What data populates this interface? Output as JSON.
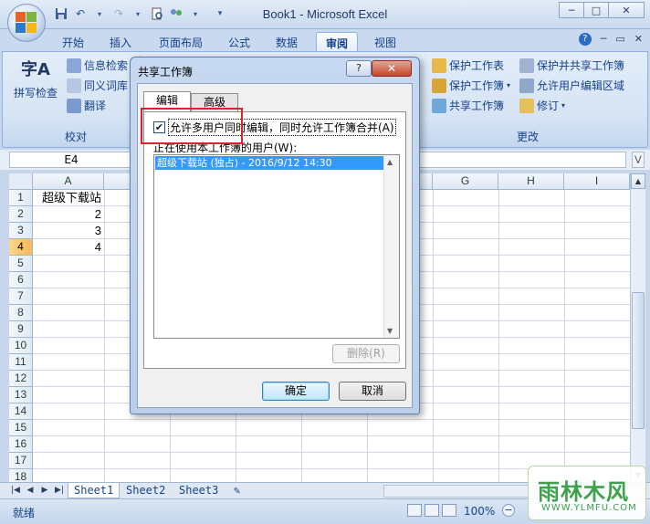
{
  "window": {
    "title": "Book1 - Microsoft Excel",
    "minimize": "─",
    "maximize": "□",
    "close": "✕"
  },
  "qat": {
    "save_icon": "save-icon",
    "undo_icon": "undo-icon",
    "redo_icon": "redo-icon",
    "dropdown": "▾"
  },
  "ribbon_tabs": [
    {
      "label": "开始"
    },
    {
      "label": "插入"
    },
    {
      "label": "页面布局"
    },
    {
      "label": "公式"
    },
    {
      "label": "数据"
    },
    {
      "label": "审阅"
    },
    {
      "label": "视图"
    }
  ],
  "help": {
    "help_icon": "?",
    "min": "─",
    "restore": "▭",
    "close": "✕"
  },
  "ribbon": {
    "proofing": {
      "spell_check": "拼写检查",
      "spell_icon_text": "字A",
      "research": "信息检索",
      "thesaurus": "同义词库",
      "translate": "翻译",
      "group_label": "校对"
    },
    "changes": {
      "protect_sheet": "保护工作表",
      "protect_workbook": "保护工作簿",
      "share_workbook": "共享工作簿",
      "protect_share": "保护并共享工作簿",
      "allow_edit_ranges": "允许用户编辑区域",
      "track_changes": "修订",
      "group_label": "更改"
    }
  },
  "namebox": {
    "value": "E4"
  },
  "columns": [
    "A",
    "B",
    "C",
    "D",
    "E",
    "F",
    "G",
    "H",
    "I"
  ],
  "rows": [
    "1",
    "2",
    "3",
    "4",
    "5",
    "6",
    "7",
    "8",
    "9",
    "10",
    "11",
    "12",
    "13",
    "14",
    "15",
    "16",
    "17",
    "18"
  ],
  "cells": {
    "A1": "超级下载站",
    "A2": "2",
    "A3": "3",
    "A4": "4"
  },
  "sheets": [
    {
      "label": "Sheet1"
    },
    {
      "label": "Sheet2"
    },
    {
      "label": "Sheet3"
    }
  ],
  "status": {
    "ready": "就绪",
    "zoom": "100%"
  },
  "dialog": {
    "title": "共享工作簿",
    "help": "?",
    "close": "✕",
    "tabs": [
      {
        "label": "编辑"
      },
      {
        "label": "高级"
      }
    ],
    "allow_multi_user": "允许多用户同时编辑，同时允许工作簿合并(A)",
    "allow_multi_user_checked": true,
    "users_label": "正在使用本工作簿的用户(W):",
    "users": [
      "超级下载站 (独占) - 2016/9/12 14:30"
    ],
    "remove": "删除(R)",
    "ok": "确定",
    "cancel": "取消"
  },
  "watermark": {
    "main": "雨林木风",
    "sub": "WWW.YLMFU.COM"
  },
  "colors": {
    "accent": "#15428b",
    "selected_row": "#f9b85a",
    "highlight_box": "#e0202b",
    "list_selection": "#3399ff"
  }
}
